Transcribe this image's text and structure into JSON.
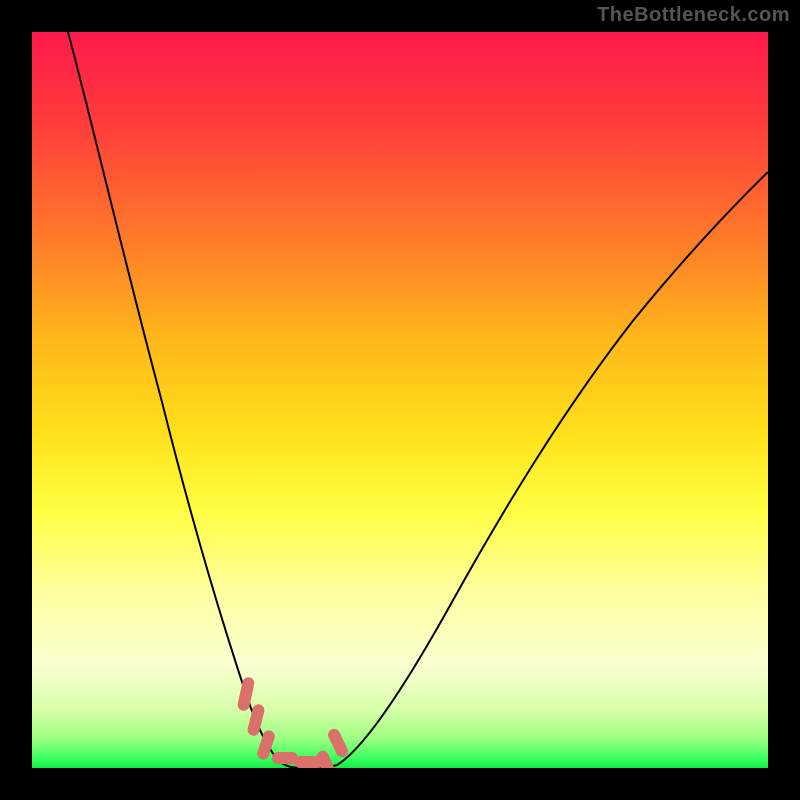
{
  "watermark": "TheBottleneck.com",
  "chart_data": {
    "type": "line",
    "title": "",
    "xlabel": "",
    "ylabel": "",
    "xlim": [
      0,
      100
    ],
    "ylim": [
      0,
      100
    ],
    "grid": false,
    "series": [
      {
        "name": "bottleneck-curve",
        "x": [
          5,
          8,
          11,
          14,
          17,
          20,
          23,
          26,
          28,
          30,
          32,
          33.5,
          35,
          37,
          40,
          45,
          50,
          55,
          60,
          65,
          70,
          75,
          80,
          85,
          90,
          95,
          100
        ],
        "y": [
          100,
          90,
          80,
          70,
          60,
          51,
          42,
          33,
          25,
          18,
          11,
          6,
          2,
          0,
          0,
          4,
          10,
          18,
          27,
          36,
          45,
          53,
          60,
          66,
          72,
          77,
          82
        ]
      }
    ],
    "optimal_zone": {
      "x": [
        28,
        42
      ],
      "y_threshold": 5,
      "comment": "lozenge markers near curve minimum"
    },
    "background_gradient_stops": [
      {
        "pos": 0,
        "color": "#ff1a4d"
      },
      {
        "pos": 50,
        "color": "#ffff44"
      },
      {
        "pos": 100,
        "color": "#18e848"
      }
    ]
  }
}
